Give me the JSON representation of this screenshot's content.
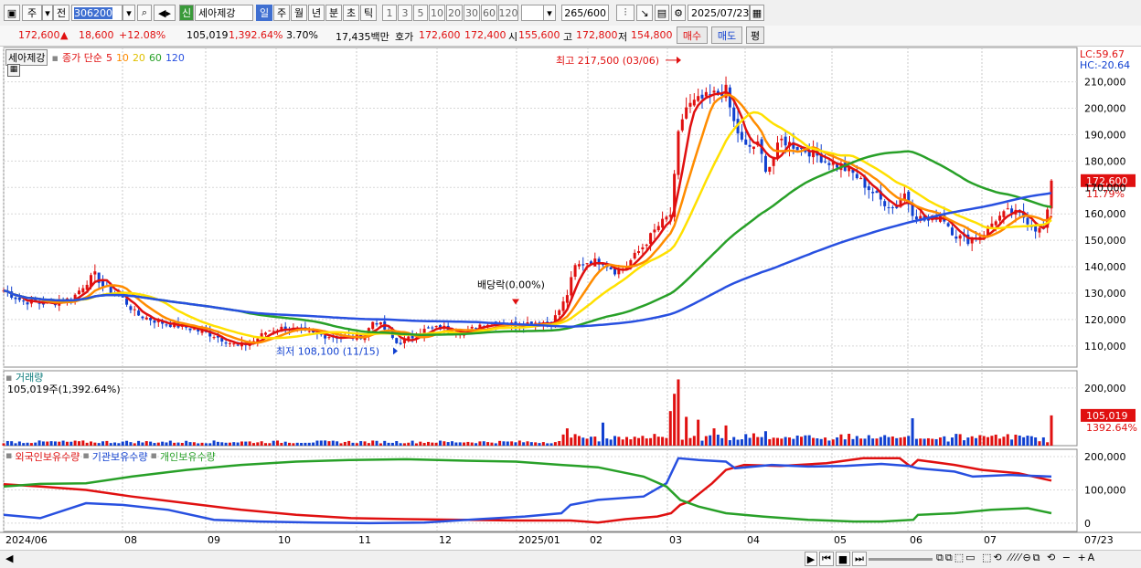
{
  "toolbar": {
    "period_day": "주",
    "mode": "전",
    "stock_code": "306200",
    "sym_badge": "신",
    "stock_name": "세아제강",
    "periods": [
      "일",
      "주",
      "월",
      "년",
      "분",
      "초",
      "틱"
    ],
    "minutes": [
      "1",
      "3",
      "5",
      "10",
      "20",
      "30",
      "60",
      "120"
    ],
    "count_value": "265",
    "count_total": "/600",
    "date": "2025/07/23"
  },
  "quote": {
    "price": "172,600",
    "change": "18,600",
    "change_pct": "+12.08%",
    "volume": "105,019",
    "volume_ratio": "1,392.64%",
    "turnover": "3.70%",
    "amount": "17,435백만",
    "bid_label": "호가",
    "ask_price": "172,600",
    "bid_price": "172,400",
    "open_label": "시",
    "open": "155,600",
    "high_label": "고",
    "high": "172,800",
    "low_label": "저",
    "low": "154,800",
    "buy": "매수",
    "sell": "매도",
    "eval": "평"
  },
  "chart_data": [
    {
      "type": "candlestick",
      "panel": "price",
      "title": "세아제강",
      "ma_label": "종가 단순",
      "ma_periods": [
        "5",
        "10",
        "20",
        "60",
        "120"
      ],
      "ma_colors": [
        "#e01010",
        "#ff8c00",
        "#ffe000",
        "#28a028",
        "#2850e0"
      ],
      "ylim": [
        102000,
        223000
      ],
      "yticks": [
        "110,000",
        "120,000",
        "130,000",
        "140,000",
        "150,000",
        "160,000",
        "170,000",
        "180,000",
        "190,000",
        "200,000",
        "210,000"
      ],
      "lc": "LC:59.67",
      "hc": "HC:-20.64",
      "current_price_label": "172,600",
      "current_pct_label": "11.79%",
      "current_price": 172600,
      "annotation_high": "최고 217,500 (03/06)",
      "high_value": 217500,
      "annotation_low": "최저 108,100 (11/15)",
      "low_value": 108100,
      "annotation_dividend": "배당락(0.00%)",
      "close_path": [
        [
          0,
          131000
        ],
        [
          20,
          127000
        ],
        [
          50,
          126000
        ],
        [
          75,
          128000
        ],
        [
          90,
          134000
        ],
        [
          100,
          137000
        ],
        [
          110,
          132000
        ],
        [
          130,
          128000
        ],
        [
          145,
          122000
        ],
        [
          170,
          119000
        ],
        [
          200,
          117000
        ],
        [
          230,
          114000
        ],
        [
          255,
          110000
        ],
        [
          270,
          111000
        ],
        [
          290,
          116000
        ],
        [
          310,
          117000
        ],
        [
          330,
          115000
        ],
        [
          350,
          114000
        ],
        [
          375,
          113000
        ],
        [
          395,
          114000
        ],
        [
          405,
          120000
        ],
        [
          415,
          117000
        ],
        [
          430,
          111000
        ],
        [
          445,
          113000
        ],
        [
          460,
          116000
        ],
        [
          480,
          117000
        ],
        [
          505,
          115000
        ],
        [
          520,
          118000
        ],
        [
          540,
          119000
        ],
        [
          560,
          118000
        ],
        [
          580,
          119000
        ],
        [
          600,
          119000
        ],
        [
          615,
          128000
        ],
        [
          625,
          140000
        ],
        [
          640,
          142000
        ],
        [
          655,
          142000
        ],
        [
          670,
          138000
        ],
        [
          680,
          140000
        ],
        [
          700,
          148000
        ],
        [
          715,
          155000
        ],
        [
          730,
          160000
        ],
        [
          738,
          190000
        ],
        [
          745,
          200000
        ],
        [
          760,
          203000
        ],
        [
          775,
          205000
        ],
        [
          790,
          207000
        ],
        [
          797,
          196000
        ],
        [
          810,
          185000
        ],
        [
          825,
          186000
        ],
        [
          835,
          176000
        ],
        [
          850,
          188000
        ],
        [
          870,
          185000
        ],
        [
          885,
          183000
        ],
        [
          900,
          180000
        ],
        [
          915,
          178000
        ],
        [
          930,
          175000
        ],
        [
          945,
          170000
        ],
        [
          960,
          165000
        ],
        [
          975,
          162000
        ],
        [
          985,
          168000
        ],
        [
          995,
          160000
        ],
        [
          1010,
          157000
        ],
        [
          1025,
          160000
        ],
        [
          1040,
          152000
        ],
        [
          1055,
          150000
        ],
        [
          1070,
          152000
        ],
        [
          1085,
          158000
        ],
        [
          1100,
          161000
        ],
        [
          1115,
          159000
        ],
        [
          1130,
          154000
        ],
        [
          1140,
          154000
        ],
        [
          1145,
          172600
        ]
      ]
    },
    {
      "type": "bar",
      "panel": "volume",
      "title": "거래량",
      "subtitle": "105,019주(1,392.64%)",
      "ylim": [
        0,
        260000
      ],
      "yticks": [
        "200,000"
      ],
      "current_label": "105,019",
      "current_pct_label": "1392.64%",
      "spikes": [
        [
          615,
          60000
        ],
        [
          625,
          40000
        ],
        [
          655,
          80000
        ],
        [
          680,
          30000
        ],
        [
          700,
          20000
        ],
        [
          730,
          120000
        ],
        [
          735,
          180000
        ],
        [
          740,
          230000
        ],
        [
          748,
          100000
        ],
        [
          760,
          90000
        ],
        [
          775,
          60000
        ],
        [
          790,
          70000
        ],
        [
          810,
          40000
        ],
        [
          835,
          50000
        ],
        [
          855,
          30000
        ],
        [
          880,
          20000
        ],
        [
          925,
          20000
        ],
        [
          960,
          30000
        ],
        [
          985,
          30000
        ],
        [
          995,
          95000
        ],
        [
          1040,
          25000
        ],
        [
          1085,
          20000
        ],
        [
          1145,
          105019
        ]
      ]
    },
    {
      "type": "line",
      "panel": "holdings",
      "series": [
        {
          "name": "외국인보유수량",
          "color": "#e01010",
          "points": [
            [
              0,
              117000
            ],
            [
              40,
              110000
            ],
            [
              90,
              100000
            ],
            [
              140,
              80000
            ],
            [
              200,
              60000
            ],
            [
              260,
              40000
            ],
            [
              320,
              25000
            ],
            [
              380,
              15000
            ],
            [
              440,
              12000
            ],
            [
              500,
              10000
            ],
            [
              560,
              8000
            ],
            [
              620,
              8000
            ],
            [
              650,
              2000
            ],
            [
              680,
              12000
            ],
            [
              715,
              20000
            ],
            [
              730,
              30000
            ],
            [
              740,
              55000
            ],
            [
              750,
              65000
            ],
            [
              775,
              120000
            ],
            [
              790,
              160000
            ],
            [
              810,
              175000
            ],
            [
              850,
              172000
            ],
            [
              900,
              180000
            ],
            [
              940,
              195000
            ],
            [
              980,
              195000
            ],
            [
              992,
              170000
            ],
            [
              1000,
              190000
            ],
            [
              1040,
              175000
            ],
            [
              1070,
              160000
            ],
            [
              1110,
              150000
            ],
            [
              1146,
              128000
            ]
          ]
        },
        {
          "name": "기관보유수량",
          "color": "#2850e0",
          "points": [
            [
              0,
              25000
            ],
            [
              40,
              15000
            ],
            [
              90,
              60000
            ],
            [
              130,
              55000
            ],
            [
              180,
              40000
            ],
            [
              230,
              10000
            ],
            [
              280,
              5000
            ],
            [
              340,
              2000
            ],
            [
              400,
              0
            ],
            [
              460,
              2000
            ],
            [
              520,
              12000
            ],
            [
              570,
              20000
            ],
            [
              610,
              30000
            ],
            [
              620,
              55000
            ],
            [
              650,
              70000
            ],
            [
              700,
              80000
            ],
            [
              725,
              120000
            ],
            [
              738,
              195000
            ],
            [
              760,
              190000
            ],
            [
              790,
              185000
            ],
            [
              800,
              165000
            ],
            [
              840,
              175000
            ],
            [
              880,
              170000
            ],
            [
              920,
              172000
            ],
            [
              960,
              178000
            ],
            [
              990,
              172000
            ],
            [
              1000,
              165000
            ],
            [
              1040,
              155000
            ],
            [
              1060,
              140000
            ],
            [
              1100,
              145000
            ],
            [
              1146,
              140000
            ]
          ]
        },
        {
          "name": "개인보유수량",
          "color": "#28a028",
          "points": [
            [
              0,
              110000
            ],
            [
              40,
              118000
            ],
            [
              90,
              120000
            ],
            [
              140,
              140000
            ],
            [
              200,
              160000
            ],
            [
              260,
              175000
            ],
            [
              320,
              185000
            ],
            [
              380,
              190000
            ],
            [
              440,
              192000
            ],
            [
              500,
              188000
            ],
            [
              560,
              185000
            ],
            [
              610,
              175000
            ],
            [
              650,
              168000
            ],
            [
              700,
              140000
            ],
            [
              725,
              110000
            ],
            [
              740,
              70000
            ],
            [
              760,
              50000
            ],
            [
              790,
              30000
            ],
            [
              830,
              20000
            ],
            [
              880,
              10000
            ],
            [
              930,
              5000
            ],
            [
              960,
              5000
            ],
            [
              995,
              10000
            ],
            [
              1000,
              25000
            ],
            [
              1040,
              30000
            ],
            [
              1080,
              40000
            ],
            [
              1120,
              45000
            ],
            [
              1146,
              30000
            ]
          ]
        }
      ],
      "ylim": [
        -25000,
        222000
      ],
      "yticks": [
        "200,000",
        "100,000",
        "0"
      ]
    }
  ],
  "x_axis": {
    "labels": [
      "2024/06",
      "08",
      "09",
      "10",
      "11",
      "12",
      "2025/01",
      "02",
      "03",
      "04",
      "05",
      "06",
      "07"
    ],
    "end_label": "07/23"
  }
}
